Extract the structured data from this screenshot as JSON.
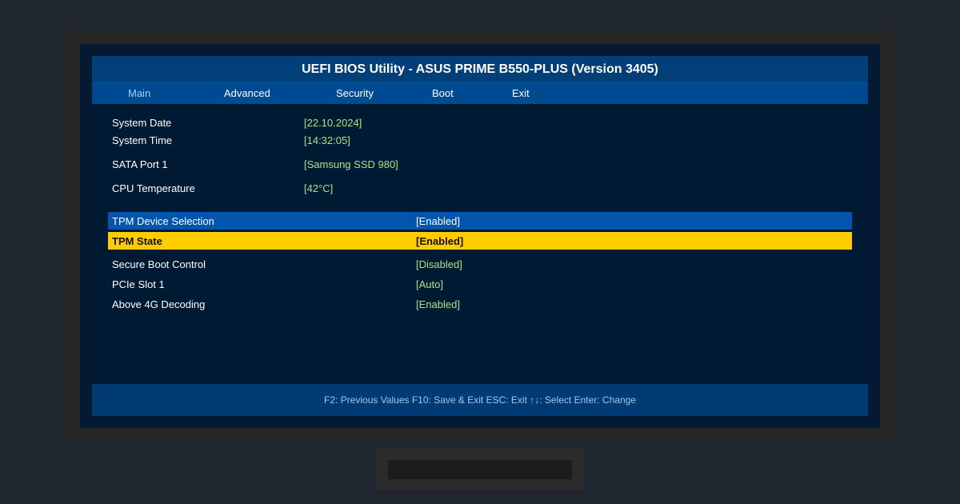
{
  "title": "UEFI BIOS Utility - ASUS PRIME B550-PLUS (Version 3405)",
  "menu": [
    {
      "label": "Main",
      "active": true
    },
    {
      "label": "Advanced",
      "active": false
    },
    {
      "label": "Security",
      "active": false
    },
    {
      "label": "Boot",
      "active": false
    },
    {
      "label": "Exit",
      "active": false
    }
  ],
  "info": {
    "system_date": {
      "label": "System Date",
      "value": "[22.10.2024]"
    },
    "system_time": {
      "label": "System Time",
      "value": "[14:32:05]"
    },
    "sata_port_1": {
      "label": "SATA Port 1",
      "value": "[Samsung SSD 980]"
    },
    "cpu_temperature": {
      "label": "CPU Temperature",
      "value": "[42°C]"
    }
  },
  "settings": {
    "tpm_device_selection": {
      "label": "TPM Device Selection",
      "value": "[Enabled]"
    },
    "tpm_state": {
      "label": "TPM State",
      "value": "[Enabled]"
    },
    "secure_boot_control": {
      "label": "Secure Boot Control",
      "value": "[Disabled]"
    },
    "pcie_slot_1": {
      "label": "PCIe Slot 1",
      "value": "[Auto]"
    },
    "above_4g_decoding": {
      "label": "Above 4G Decoding",
      "value": "[Enabled]"
    }
  },
  "status_bar": "F2: Previous Values F10: Save & Exit ESC: Exit ↑↓: Select Enter: Change",
  "colors": {
    "title_bar": "#003f78",
    "menu_bar": "#004a91",
    "background": "#001a33",
    "value_text": "#a6e38a",
    "selection_blue": "#0056ad",
    "selection_yellow": "#ffcc00"
  }
}
